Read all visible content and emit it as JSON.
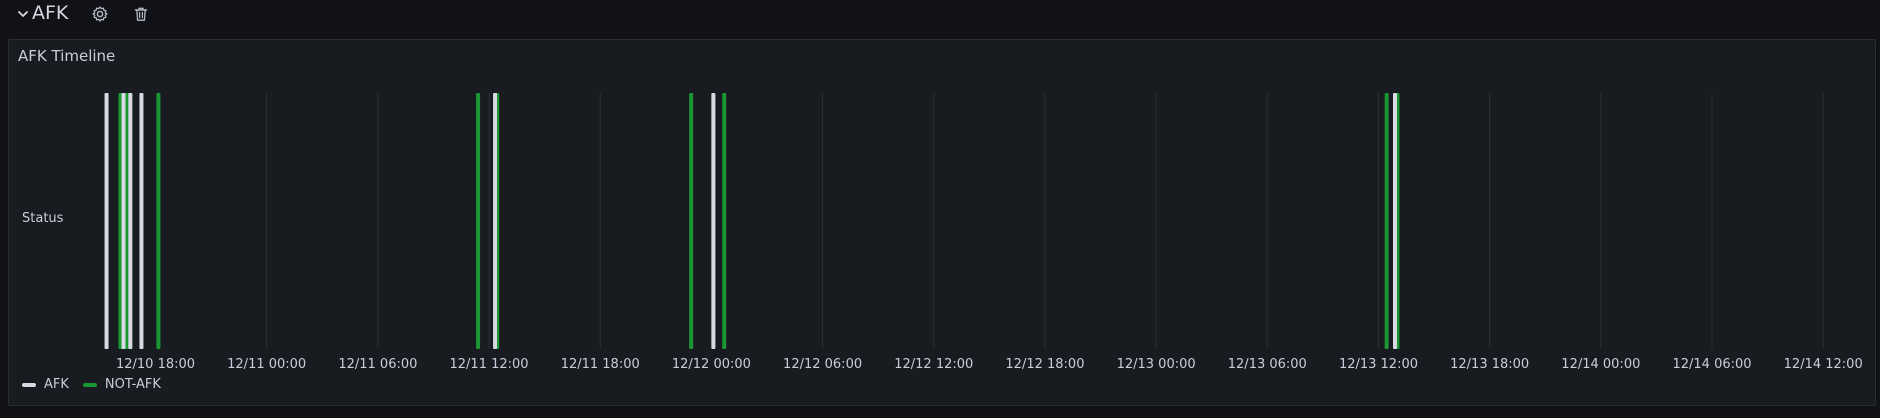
{
  "row": {
    "title": "AFK",
    "icons": [
      "chevron-down-icon",
      "gear-icon",
      "trash-icon"
    ]
  },
  "panel": {
    "title": "AFK Timeline",
    "row_label": "Status"
  },
  "colors": {
    "afk": "#d9d9e3",
    "not_afk": "#1a9632",
    "grid": "#2c2f35",
    "background": "#181b1f"
  },
  "chart_data": {
    "type": "state-timeline",
    "title": "AFK Timeline",
    "row_label": "Status",
    "x_range": [
      "12/10 15:15",
      "12/14 15:00"
    ],
    "x_ticks": [
      "12/10 18:00",
      "12/11 00:00",
      "12/11 06:00",
      "12/11 12:00",
      "12/11 18:00",
      "12/12 00:00",
      "12/12 06:00",
      "12/12 12:00",
      "12/12 18:00",
      "12/13 00:00",
      "12/13 06:00",
      "12/13 12:00",
      "12/13 18:00",
      "12/14 00:00",
      "12/14 06:00",
      "12/14 12:00"
    ],
    "grid": true,
    "legend": [
      "AFK",
      "NOT-AFK"
    ],
    "legend_placement": "bottom-left",
    "segments": [
      {
        "start": "12/10 15:15",
        "end": "12/10 15:20",
        "state": "AFK"
      },
      {
        "start": "12/10 16:00",
        "end": "12/10 16:45",
        "state": "NOT-AFK"
      },
      {
        "start": "12/10 16:10",
        "end": "12/10 16:13",
        "state": "AFK"
      },
      {
        "start": "12/10 16:32",
        "end": "12/10 16:35",
        "state": "AFK"
      },
      {
        "start": "12/10 17:08",
        "end": "12/10 17:13",
        "state": "AFK"
      },
      {
        "start": "12/10 18:03",
        "end": "12/10 18:09",
        "state": "NOT-AFK"
      },
      {
        "start": "12/11 11:18",
        "end": "12/11 11:24",
        "state": "NOT-AFK"
      },
      {
        "start": "12/11 12:13",
        "end": "12/11 12:18",
        "state": "AFK"
      },
      {
        "start": "12/11 12:20",
        "end": "12/11 12:25",
        "state": "NOT-AFK"
      },
      {
        "start": "12/11 22:48",
        "end": "12/11 22:54",
        "state": "NOT-AFK"
      },
      {
        "start": "12/12 00:00",
        "end": "12/12 00:10",
        "state": "AFK"
      },
      {
        "start": "12/12 00:35",
        "end": "12/12 00:40",
        "state": "NOT-AFK"
      },
      {
        "start": "12/13 12:20",
        "end": "12/13 12:26",
        "state": "NOT-AFK"
      },
      {
        "start": "12/13 12:47",
        "end": "12/13 12:52",
        "state": "AFK"
      },
      {
        "start": "12/13 12:55",
        "end": "12/13 13:04",
        "state": "NOT-AFK"
      }
    ]
  },
  "legend": {
    "afk_label": "AFK",
    "not_afk_label": "NOT-AFK"
  }
}
